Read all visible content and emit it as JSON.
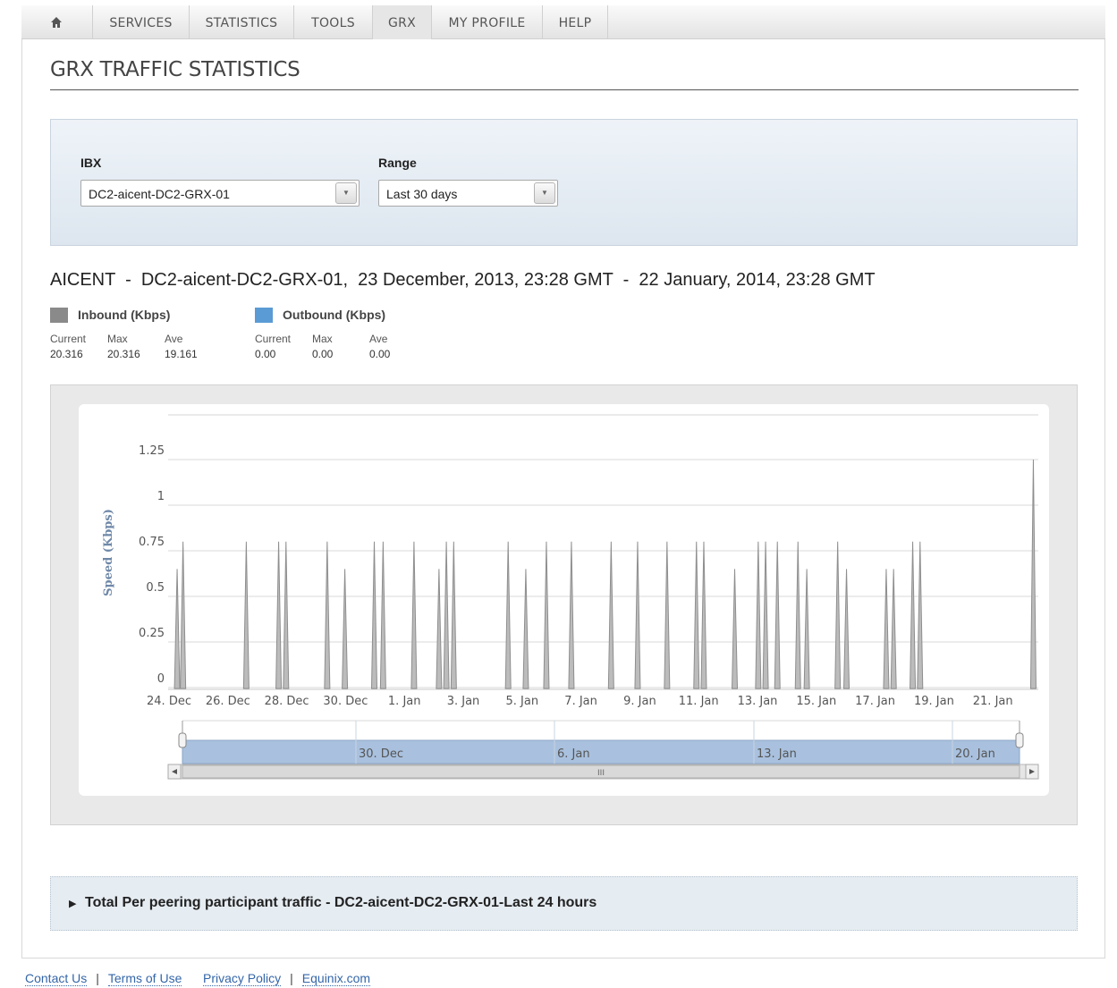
{
  "nav": {
    "home_icon": "home-icon",
    "items": [
      {
        "label": "SERVICES"
      },
      {
        "label": "STATISTICS"
      },
      {
        "label": "TOOLS"
      },
      {
        "label": "GRX"
      },
      {
        "label": "MY PROFILE"
      },
      {
        "label": "HELP"
      }
    ],
    "active": "GRX"
  },
  "page": {
    "title": "GRX TRAFFIC STATISTICS"
  },
  "filters": {
    "ibx_label": "IBX",
    "ibx_value": "DC2-aicent-DC2-GRX-01",
    "range_label": "Range",
    "range_value": "Last 30 days"
  },
  "summary": {
    "header": "AICENT  -  DC2-aicent-DC2-GRX-01,  23 December, 2013, 23:28 GMT  -  22 January, 2014, 23:28 GMT",
    "inbound": {
      "title": "Inbound (Kbps)",
      "color": "#8a8a8a",
      "heads": [
        "Current",
        "Max",
        "Ave"
      ],
      "values": [
        "20.316",
        "20.316",
        "19.161"
      ]
    },
    "outbound": {
      "title": "Outbound (Kbps)",
      "color": "#5b9bd5",
      "heads": [
        "Current",
        "Max",
        "Ave"
      ],
      "values": [
        "0.00",
        "0.00",
        "0.00"
      ]
    }
  },
  "chart_data": {
    "type": "area",
    "ylabel": "Speed (Kbps)",
    "ylim": [
      0,
      1.25
    ],
    "y_ticks": [
      "0",
      "0.25",
      "0.5",
      "0.75",
      "1",
      "1.25"
    ],
    "x_tick_labels": [
      "24. Dec",
      "26. Dec",
      "28. Dec",
      "30. Dec",
      "1. Jan",
      "3. Jan",
      "5. Jan",
      "7. Jan",
      "9. Jan",
      "11. Jan",
      "13. Jan",
      "15. Jan",
      "17. Jan",
      "19. Jan",
      "21. Jan"
    ],
    "series": [
      {
        "values_note": "spikes (day offset from 24 Dec, value)",
        "spikes": [
          [
            -0.15,
            0.65
          ],
          [
            0.05,
            0.8
          ],
          [
            2.2,
            0.8
          ],
          [
            3.3,
            0.8
          ],
          [
            3.55,
            0.8
          ],
          [
            4.95,
            0.8
          ],
          [
            5.55,
            0.65
          ],
          [
            6.55,
            0.8
          ],
          [
            6.85,
            0.8
          ],
          [
            7.9,
            0.8
          ],
          [
            8.75,
            0.65
          ],
          [
            9.0,
            0.8
          ],
          [
            9.25,
            0.8
          ],
          [
            11.1,
            0.8
          ],
          [
            11.7,
            0.65
          ],
          [
            12.4,
            0.8
          ],
          [
            13.25,
            0.8
          ],
          [
            14.6,
            0.8
          ],
          [
            15.5,
            0.8
          ],
          [
            16.5,
            0.8
          ],
          [
            17.5,
            0.8
          ],
          [
            17.75,
            0.8
          ],
          [
            18.8,
            0.65
          ],
          [
            19.6,
            0.8
          ],
          [
            19.85,
            0.8
          ],
          [
            20.25,
            0.8
          ],
          [
            20.95,
            0.8
          ],
          [
            21.25,
            0.65
          ],
          [
            22.3,
            0.8
          ],
          [
            22.6,
            0.65
          ],
          [
            23.95,
            0.65
          ],
          [
            24.2,
            0.65
          ],
          [
            24.85,
            0.8
          ],
          [
            25.1,
            0.8
          ],
          [
            28.95,
            1.25
          ]
        ]
      }
    ],
    "navigator_labels": [
      "30. Dec",
      "6. Jan",
      "13. Jan",
      "20. Jan"
    ],
    "scrollbar_grip": "III"
  },
  "expander": {
    "label": "Total Per peering participant traffic - DC2-aicent-DC2-GRX-01-Last 24 hours"
  },
  "footer": {
    "links": [
      "Contact Us",
      "Terms of Use",
      "Privacy Policy",
      "Equinix.com"
    ]
  }
}
